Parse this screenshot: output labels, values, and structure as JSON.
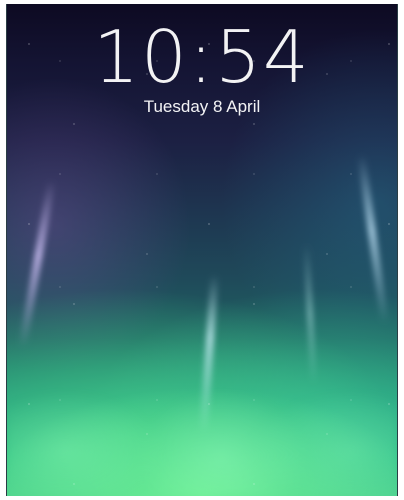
{
  "lock_screen": {
    "time": "10:54",
    "date": "Tuesday 8 April"
  },
  "colors": {
    "sky_top": "#0d0a22",
    "sky_mid": "#1e3550",
    "aurora_green": "#52d58e",
    "text": "#ffffff"
  }
}
